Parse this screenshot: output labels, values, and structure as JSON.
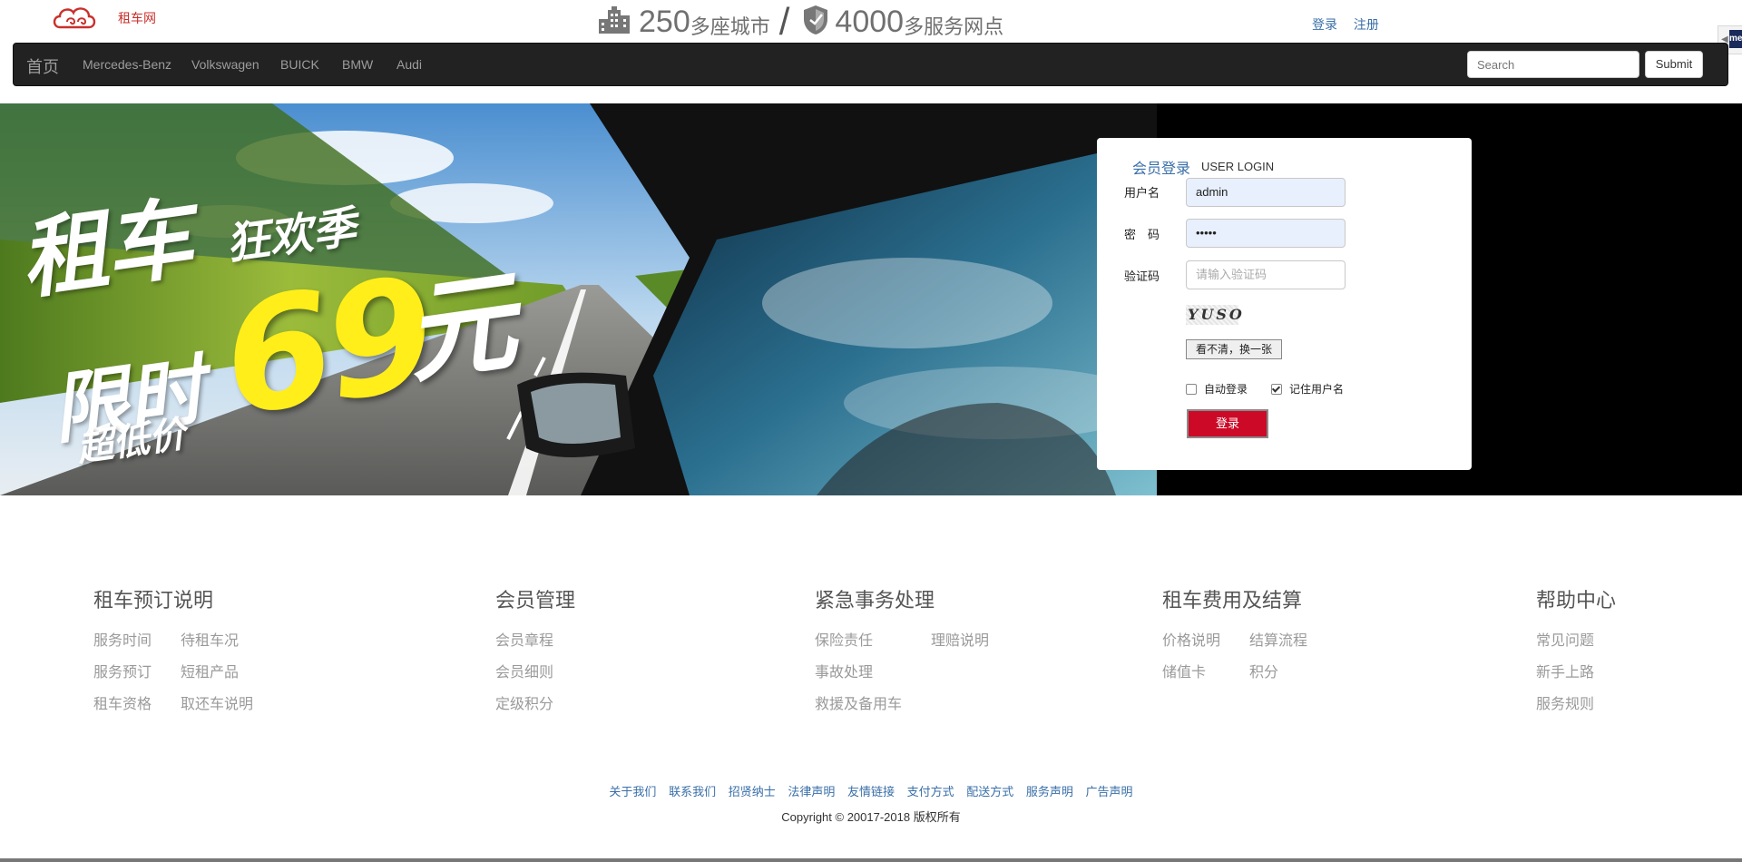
{
  "header": {
    "logo_text": "租车网",
    "stats": [
      {
        "number": "250",
        "unit": "多座城市"
      },
      {
        "number": "4000",
        "unit": "多服务网点"
      }
    ],
    "stat_separator": "/",
    "login_link": "登录",
    "register_link": "注册",
    "side_badge": "me"
  },
  "navbar": {
    "brand": "首页",
    "items": [
      "Mercedes-Benz",
      "Volkswagen",
      "BUICK",
      "BMW",
      "Audi"
    ],
    "search_placeholder": "Search",
    "submit_label": "Submit"
  },
  "banner": {
    "line1": "租车",
    "line1_tag": "狂欢季",
    "line2": "限时",
    "price": "69",
    "price_unit": "元",
    "line3": "超低价"
  },
  "login": {
    "title": "会员登录",
    "title_en": "USER LOGIN",
    "username_label": "用户名",
    "username_value": "admin",
    "password_label": "密　码",
    "password_value": "•••••",
    "captcha_label": "验证码",
    "captcha_placeholder": "请输入验证码",
    "captcha_image_text": "YUSO",
    "refresh_label": "看不清，换一张",
    "auto_login_label": "自动登录",
    "auto_login_checked": false,
    "remember_label": "记住用户名",
    "remember_checked": true,
    "submit_label": "登录"
  },
  "footer": {
    "columns": [
      {
        "title": "租车预订说明",
        "links": [
          "服务时间",
          "待租车况",
          "服务预订",
          "短租产品",
          "租车资格",
          "取还车说明"
        ]
      },
      {
        "title": "会员管理",
        "links": [
          "会员章程",
          "会员细则",
          "定级积分"
        ]
      },
      {
        "title": "紧急事务处理",
        "links": [
          "保险责任",
          "理赔说明",
          "事故处理",
          "救援及备用车"
        ]
      },
      {
        "title": "租车费用及结算",
        "links": [
          "价格说明",
          "结算流程",
          "储值卡",
          "积分"
        ]
      },
      {
        "title": "帮助中心",
        "links": [
          "常见问题",
          "新手上路",
          "服务规则"
        ]
      }
    ],
    "bottom_links": [
      "关于我们",
      "联系我们",
      "招贤纳士",
      "法律声明",
      "友情链接",
      "支付方式",
      "配送方式",
      "服务声明",
      "广告声明"
    ],
    "copyright": "Copyright © 20017-2018 版权所有"
  },
  "colors": {
    "navbar_bg": "#222222",
    "link_blue": "#3a6fa8",
    "login_button": "#cc0a28",
    "price_yellow": "#ffee1a",
    "logo_red": "#c9302c"
  }
}
